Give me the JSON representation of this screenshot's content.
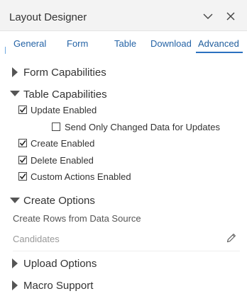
{
  "header": {
    "title": "Layout Designer",
    "minimize_icon": "chevron-down-icon",
    "close_icon": "close-icon"
  },
  "tabs": [
    {
      "label": "General",
      "active": false
    },
    {
      "label": "Form",
      "active": false
    },
    {
      "label": "Table",
      "active": false
    },
    {
      "label": "Download",
      "active": false
    },
    {
      "label": "Advanced",
      "active": true
    }
  ],
  "sections": {
    "form_capabilities": {
      "label": "Form Capabilities",
      "expanded": false
    },
    "table_capabilities": {
      "label": "Table Capabilities",
      "expanded": true,
      "options": {
        "update_enabled": {
          "label": "Update Enabled",
          "checked": true
        },
        "send_only_changed": {
          "label": "Send Only Changed Data for Updates",
          "checked": false
        },
        "create_enabled": {
          "label": "Create Enabled",
          "checked": true
        },
        "delete_enabled": {
          "label": "Delete Enabled",
          "checked": true
        },
        "custom_actions_enabled": {
          "label": "Custom Actions Enabled",
          "checked": true
        }
      }
    },
    "create_options": {
      "label": "Create Options",
      "expanded": true,
      "create_rows_label": "Create Rows from Data Source",
      "create_rows_value": "Candidates"
    },
    "upload_options": {
      "label": "Upload Options",
      "expanded": false
    },
    "macro_support": {
      "label": "Macro Support",
      "expanded": false
    }
  },
  "colors": {
    "accent": "#2b71c0",
    "header_bg": "#f3f3f3",
    "text": "#333333",
    "muted": "#999999"
  }
}
